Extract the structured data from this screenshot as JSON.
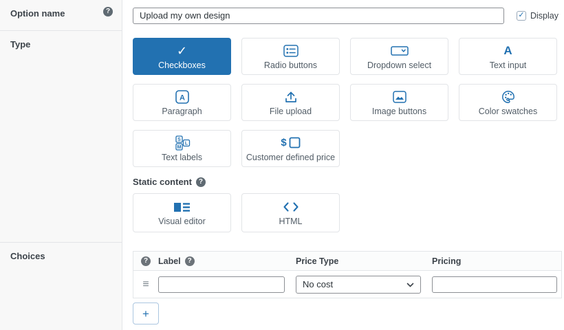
{
  "colors": {
    "accent": "#2271b1",
    "sidebar_bg": "#f8f8f8",
    "tile_border": "#e2e4e7",
    "input_border": "#8c8f94"
  },
  "icons": {
    "help": "?",
    "check": "✓",
    "plus": "+",
    "drag_handle": "≡",
    "dollar": "$",
    "letter_a": "A",
    "size_s": "S",
    "size_m": "M",
    "size_l": "L"
  },
  "option_name": {
    "label": "Option name",
    "value": "Upload my own design",
    "display": {
      "label": "Display",
      "checked": true
    }
  },
  "type": {
    "label": "Type",
    "tiles": [
      {
        "label": "Checkboxes",
        "icon": "checkmark-icon",
        "selected": true
      },
      {
        "label": "Radio buttons",
        "icon": "radio-list-icon",
        "selected": false
      },
      {
        "label": "Dropdown select",
        "icon": "dropdown-icon",
        "selected": false
      },
      {
        "label": "Text input",
        "icon": "letter-a-icon",
        "selected": false
      },
      {
        "label": "Paragraph",
        "icon": "boxed-a-icon",
        "selected": false
      },
      {
        "label": "File upload",
        "icon": "upload-icon",
        "selected": false
      },
      {
        "label": "Image buttons",
        "icon": "image-icon",
        "selected": false
      },
      {
        "label": "Color swatches",
        "icon": "palette-icon",
        "selected": false
      },
      {
        "label": "Text labels",
        "icon": "size-labels-icon",
        "selected": false
      },
      {
        "label": "Customer defined price",
        "icon": "dollar-box-icon",
        "selected": false
      }
    ],
    "static_content": {
      "label": "Static content",
      "tiles": [
        {
          "label": "Visual editor",
          "icon": "visual-editor-icon"
        },
        {
          "label": "HTML",
          "icon": "code-brackets-icon"
        }
      ]
    }
  },
  "choices": {
    "label": "Choices",
    "header": {
      "label_col": "Label",
      "price_type_col": "Price Type",
      "pricing_col": "Pricing"
    },
    "rows": [
      {
        "label_value": "",
        "price_type": "No cost",
        "pricing_value": ""
      }
    ]
  }
}
